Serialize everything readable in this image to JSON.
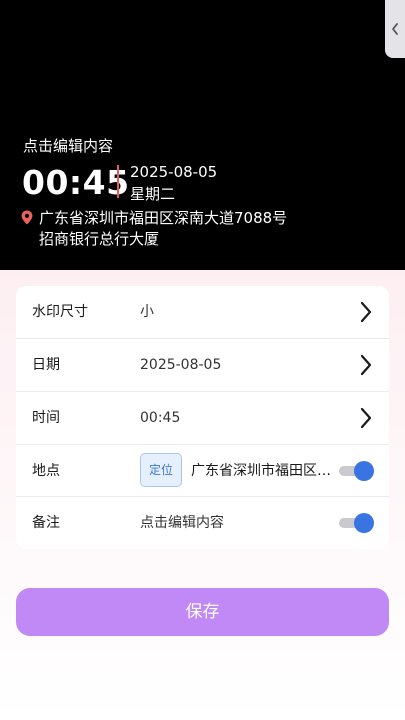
{
  "watermark": {
    "note": "点击编辑内容",
    "time": "00:45",
    "date": "2025-08-05",
    "weekday": "星期二",
    "address_line1": "广东省深圳市福田区深南大道7088号",
    "address_line2": "招商银行总行大厦",
    "divider_color": "#e85a5a",
    "pin_color": "#e8635d"
  },
  "settings": {
    "size": {
      "label": "水印尺寸",
      "value": "小"
    },
    "date": {
      "label": "日期",
      "value": "2025-08-05"
    },
    "time": {
      "label": "时间",
      "value": "00:45"
    },
    "location": {
      "label": "地点",
      "locate_label": "定位",
      "value": "广东省深圳市福田区深南大道7088号招商银行总行大厦",
      "enabled": true
    },
    "note": {
      "label": "备注",
      "value": "点击编辑内容",
      "enabled": true
    }
  },
  "actions": {
    "save_label": "保存"
  },
  "icons": {
    "side_tab": "chevron-left-icon",
    "location": "map-pin-icon",
    "row_arrow": "chevron-right-icon"
  },
  "colors": {
    "accent_purple": "#c089f5",
    "toggle_blue": "#3a73e2",
    "locate_blue": "#3d7ad4"
  }
}
